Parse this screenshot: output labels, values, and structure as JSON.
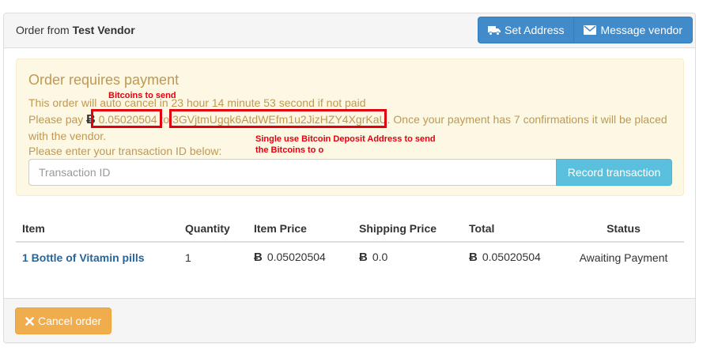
{
  "header": {
    "prefix": "Order from",
    "vendor": "Test Vendor",
    "set_address_label": "Set Address",
    "message_vendor_label": "Message vendor"
  },
  "alert": {
    "title": "Order requires payment",
    "line1": "This order will auto cancel in 23 hour 14 minute 53 second if not paid",
    "pay_prefix": "Please pay",
    "btc_symbol": "Ƀ",
    "amount": "0.05020504",
    "to_word": "to",
    "address": "3GVjtmUgqk6AtdWEfm1u2JizHZY4XgrKaU",
    "pay_suffix": ". Once your payment has 7 confirmations it will be placed with the vendor.",
    "line3": "Please enter your transaction ID below:"
  },
  "annotations": {
    "amount_note": "Bitcoins to send",
    "address_note_1": "Single use Bitcoin Deposit Address to send",
    "address_note_2": "the Bitcoins to o",
    "color": "#e3000f"
  },
  "transaction": {
    "placeholder": "Transaction ID",
    "button_label": "Record transaction"
  },
  "table": {
    "headers": {
      "item": "Item",
      "quantity": "Quantity",
      "item_price": "Item Price",
      "shipping_price": "Shipping Price",
      "total": "Total",
      "status": "Status"
    },
    "rows": [
      {
        "item": "1 Bottle of Vitamin pills",
        "quantity": "1",
        "item_price": "0.05020504",
        "shipping_price": "0.0",
        "total": "0.05020504",
        "status": "Awaiting Payment"
      }
    ],
    "btc_symbol": "Ƀ"
  },
  "footer": {
    "cancel_label": "Cancel order"
  },
  "colors": {
    "primary": "#428bca",
    "info": "#5bc0de",
    "warning": "#f0ad4e",
    "alert_bg": "#fcf8e3",
    "alert_text": "#c09853",
    "link": "#2a6496"
  }
}
